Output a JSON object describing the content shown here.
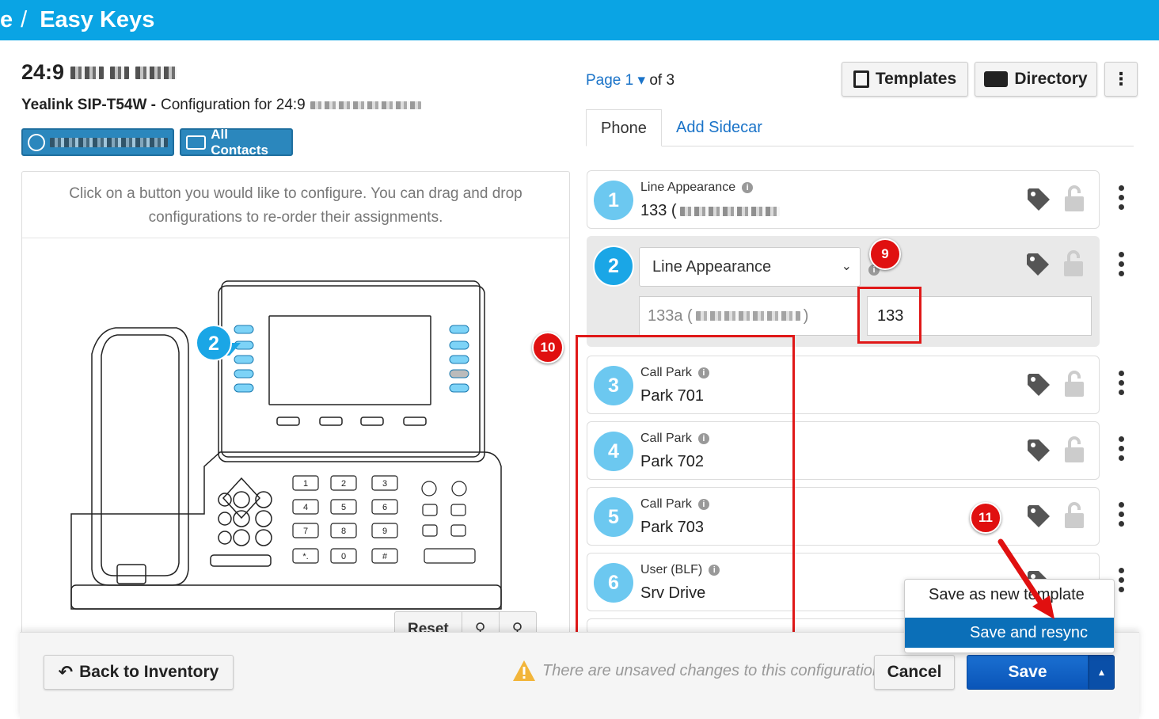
{
  "header": {
    "crumb_prefix": "e",
    "separator": "/",
    "title": "Easy Keys"
  },
  "device": {
    "mac_prefix": "24:9",
    "model": "Yealink SIP-T54W -",
    "config_label": "Configuration for 24:9"
  },
  "chips": {
    "all_contacts": "All Contacts"
  },
  "left": {
    "hint": "Click on a button you would like to configure. You can drag and drop configurations to re-order their assignments.",
    "reset": "Reset",
    "phone_callout": "2",
    "keypad": [
      "1",
      "2",
      "3",
      "4",
      "5",
      "6",
      "7",
      "8",
      "9",
      "*.",
      "0",
      "#"
    ]
  },
  "pager": {
    "prefix": "Page 1",
    "suffix": "of 3"
  },
  "toolbar": {
    "templates": "Templates",
    "directory": "Directory"
  },
  "tabs": {
    "phone": "Phone",
    "add_sidecar": "Add Sidecar"
  },
  "rows": [
    {
      "num": "1",
      "type": "Line Appearance",
      "value": "133 ("
    },
    {
      "num": "2",
      "type": "Line Appearance",
      "label_value": "133a (",
      "label_close": ")",
      "ext_value": "133"
    },
    {
      "num": "3",
      "type": "Call Park",
      "value": "Park 701"
    },
    {
      "num": "4",
      "type": "Call Park",
      "value": "Park 702"
    },
    {
      "num": "5",
      "type": "Call Park",
      "value": "Park 703"
    },
    {
      "num": "6",
      "type": "User (BLF)",
      "value": "Srv Drive"
    }
  ],
  "annotations": {
    "b9": "9",
    "b10": "10",
    "b11": "11"
  },
  "save_menu": {
    "template": "Save as new template",
    "resync": "Save and resync"
  },
  "footer": {
    "back": "Back to Inventory",
    "warning": "There are unsaved changes to this configuration",
    "cancel": "Cancel",
    "save": "Save"
  },
  "colors": {
    "accent": "#0aa4e4",
    "primary": "#0b6fb8",
    "badge": "#e01010",
    "number_circle": "#6cc8f0"
  }
}
